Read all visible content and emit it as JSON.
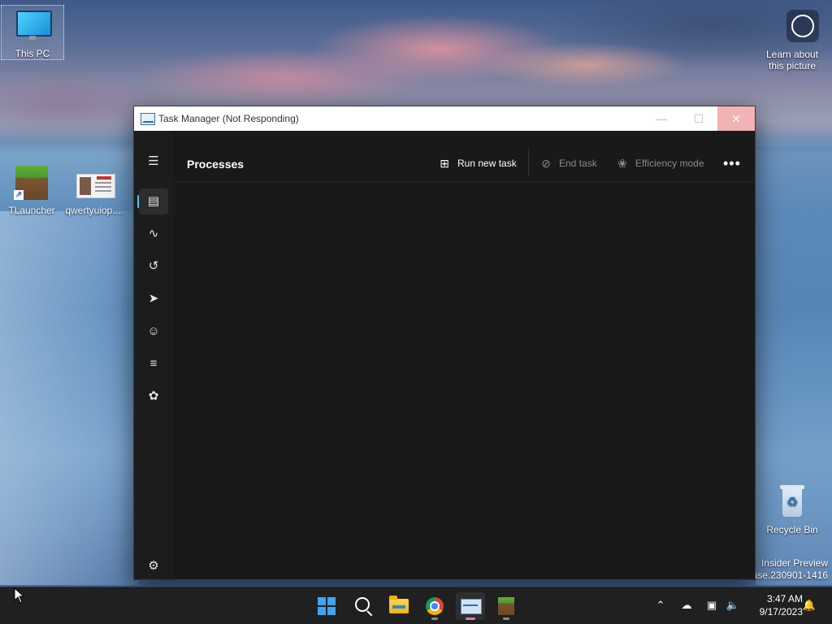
{
  "desktop": {
    "icons": [
      {
        "label": "This PC",
        "icon": "monitor-icon"
      },
      {
        "label": "TLauncher",
        "icon": "minecraft-grass-block-icon"
      },
      {
        "label": "qwertyuiop....",
        "icon": "document-thumbnail-icon"
      },
      {
        "label": "Learn about\nthis picture",
        "icon": "camera-info-icon"
      },
      {
        "label": "Recycle Bin",
        "icon": "recycle-bin-icon"
      }
    ],
    "learn_line1": "Learn about",
    "learn_line2": "this picture",
    "watermark_line1": "Insider Preview",
    "watermark_line2": "ase.230901-1416"
  },
  "task_manager": {
    "window_title": "Task Manager (Not Responding)",
    "page_title": "Processes",
    "commands": {
      "run_new_task": "Run new task",
      "end_task": "End task",
      "efficiency_mode": "Efficiency mode",
      "more": "•••"
    },
    "nav_icons": [
      "hamburger-menu-icon",
      "processes-icon",
      "performance-icon",
      "app-history-icon",
      "startup-apps-icon",
      "users-icon",
      "details-icon",
      "services-icon",
      "settings-icon"
    ]
  },
  "taskbar": {
    "apps": [
      "start-icon",
      "search-icon",
      "file-explorer-icon",
      "chrome-icon",
      "task-manager-icon",
      "minecraft-icon"
    ],
    "clock_time": "3:47 AM",
    "clock_date": "9/17/2023"
  },
  "colors": {
    "accent": "#4cc2ff",
    "window_bg": "#1c1c1c",
    "taskbar_bg": "#202020"
  }
}
